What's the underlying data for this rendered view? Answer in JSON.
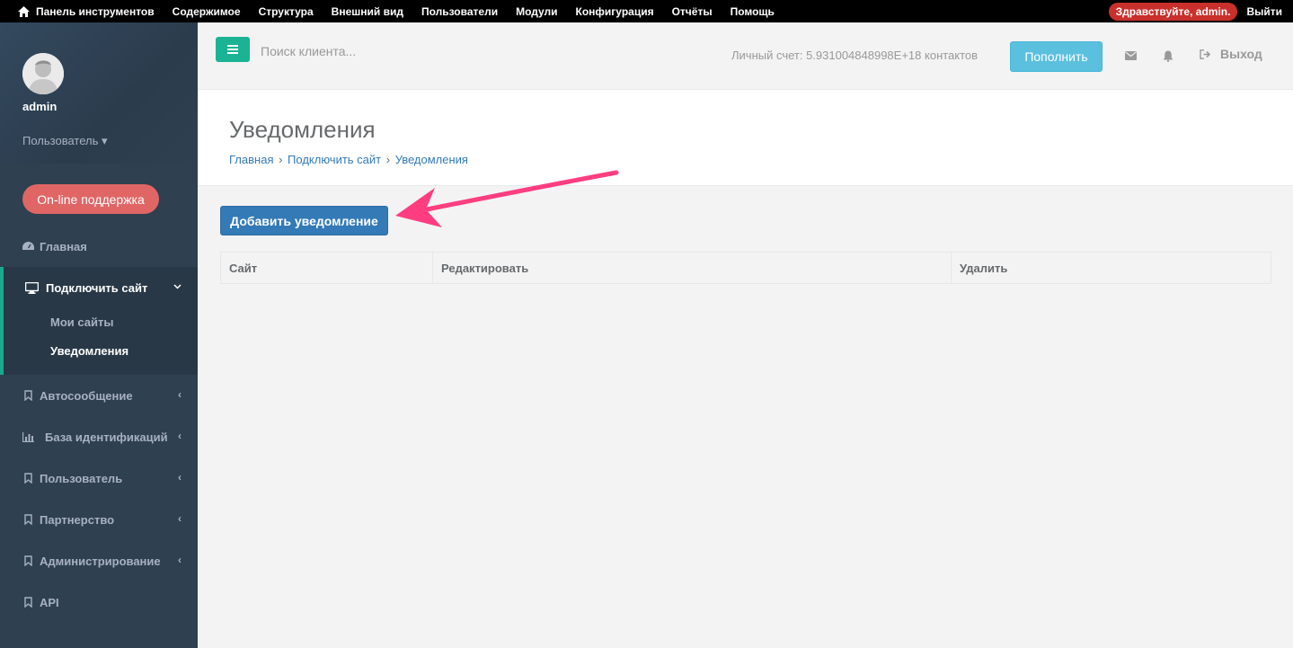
{
  "adminbar": {
    "menu": [
      "Панель инструментов",
      "Содержимое",
      "Структура",
      "Внешний вид",
      "Пользователи",
      "Модули",
      "Конфигурация",
      "Отчёты",
      "Помощь"
    ],
    "greeting": "Здравствуйте, admin.",
    "exit": "Выйти"
  },
  "sidebar": {
    "user_name": "admin",
    "user_role": "Пользователь ▾",
    "support_label": "On-line поддержка",
    "home": "Главная",
    "connect_site": "Подключить сайт",
    "sub_my_sites": "Мои сайты",
    "sub_notifications": "Уведомления",
    "items": [
      "Автосообщение",
      "База идентификаций",
      "Пользователь",
      "Партнерство",
      "Администрирование",
      "API"
    ]
  },
  "header": {
    "search_placeholder": "Поиск клиента...",
    "account": "Личный счет: 5.931004848998E+18 контактов",
    "refill": "Пополнить",
    "logout": "Выход"
  },
  "page": {
    "title": "Уведомления",
    "breadcrumb": [
      "Главная",
      "Подключить сайт",
      "Уведомления"
    ],
    "add_button": "Добавить уведомление",
    "columns": [
      "Сайт",
      "Редактировать",
      "Удалить"
    ]
  },
  "colors": {
    "sidebar": "#2f4050",
    "accent": "#1ab394",
    "primary": "#337ab7",
    "info": "#5bc0de",
    "danger": "#e06666",
    "arrow": "#ff3d7f"
  }
}
